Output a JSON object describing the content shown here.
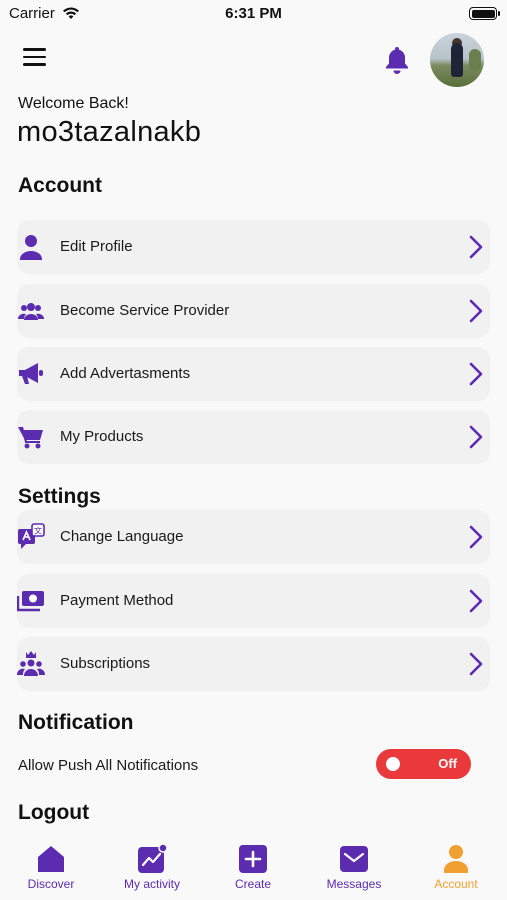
{
  "status_bar": {
    "carrier": "Carrier",
    "time": "6:31 PM"
  },
  "header": {
    "welcome": "Welcome Back!",
    "username": "mo3tazalnakb"
  },
  "account": {
    "title": "Account",
    "items": [
      {
        "label": "Edit Profile",
        "icon": "user-icon"
      },
      {
        "label": "Become Service Provider",
        "icon": "users-icon"
      },
      {
        "label": "Add Advertasments",
        "icon": "megaphone-icon"
      },
      {
        "label": "My Products",
        "icon": "cart-icon"
      }
    ]
  },
  "settings": {
    "title": "Settings",
    "items": [
      {
        "label": "Change Language",
        "icon": "language-icon"
      },
      {
        "label": "Payment Method",
        "icon": "money-icon"
      },
      {
        "label": "Subscriptions",
        "icon": "crown-users-icon"
      }
    ]
  },
  "notification": {
    "title": "Notification",
    "allow_label": "Allow Push All Notifications",
    "toggle_text": "Off",
    "enabled": false
  },
  "logout": {
    "title": "Logout"
  },
  "tabs": [
    {
      "label": "Discover",
      "icon": "home-icon"
    },
    {
      "label": "My activity",
      "icon": "activity-icon"
    },
    {
      "label": "Create",
      "icon": "plus-icon"
    },
    {
      "label": "Messages",
      "icon": "envelope-icon"
    },
    {
      "label": "Account",
      "icon": "person-icon",
      "active": true
    }
  ],
  "colors": {
    "accent": "#5b2bb0",
    "active_tab": "#f0a030",
    "toggle_off": "#e9393b"
  }
}
